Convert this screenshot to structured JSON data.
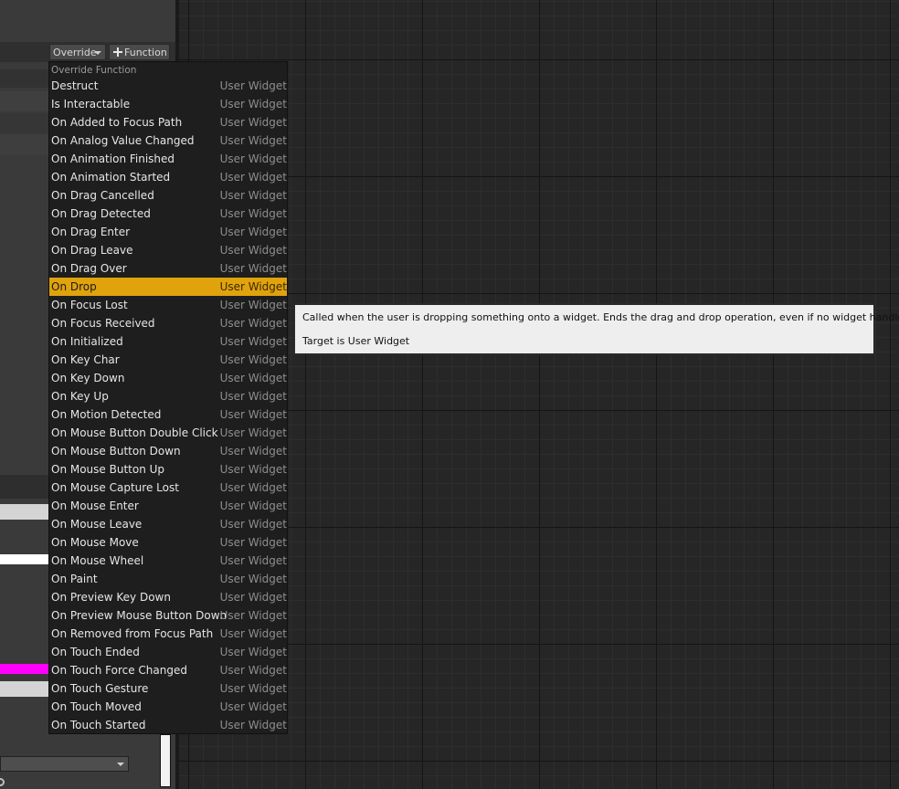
{
  "toolbar": {
    "override_label": "Override",
    "function_label": "Function"
  },
  "dropdown": {
    "header": "Override Function",
    "selected_index": 11,
    "items": [
      {
        "name": "Destruct",
        "type": "User Widget"
      },
      {
        "name": "Is Interactable",
        "type": "User Widget"
      },
      {
        "name": "On Added to Focus Path",
        "type": "User Widget"
      },
      {
        "name": "On Analog Value Changed",
        "type": "User Widget"
      },
      {
        "name": "On Animation Finished",
        "type": "User Widget"
      },
      {
        "name": "On Animation Started",
        "type": "User Widget"
      },
      {
        "name": "On Drag Cancelled",
        "type": "User Widget"
      },
      {
        "name": "On Drag Detected",
        "type": "User Widget"
      },
      {
        "name": "On Drag Enter",
        "type": "User Widget"
      },
      {
        "name": "On Drag Leave",
        "type": "User Widget"
      },
      {
        "name": "On Drag Over",
        "type": "User Widget"
      },
      {
        "name": "On Drop",
        "type": "User Widget"
      },
      {
        "name": "On Focus Lost",
        "type": "User Widget"
      },
      {
        "name": "On Focus Received",
        "type": "User Widget"
      },
      {
        "name": "On Initialized",
        "type": "User Widget"
      },
      {
        "name": "On Key Char",
        "type": "User Widget"
      },
      {
        "name": "On Key Down",
        "type": "User Widget"
      },
      {
        "name": "On Key Up",
        "type": "User Widget"
      },
      {
        "name": "On Motion Detected",
        "type": "User Widget"
      },
      {
        "name": "On Mouse Button Double Click",
        "type": "User Widget"
      },
      {
        "name": "On Mouse Button Down",
        "type": "User Widget"
      },
      {
        "name": "On Mouse Button Up",
        "type": "User Widget"
      },
      {
        "name": "On Mouse Capture Lost",
        "type": "User Widget"
      },
      {
        "name": "On Mouse Enter",
        "type": "User Widget"
      },
      {
        "name": "On Mouse Leave",
        "type": "User Widget"
      },
      {
        "name": "On Mouse Move",
        "type": "User Widget"
      },
      {
        "name": "On Mouse Wheel",
        "type": "User Widget"
      },
      {
        "name": "On Paint",
        "type": "User Widget"
      },
      {
        "name": "On Preview Key Down",
        "type": "User Widget"
      },
      {
        "name": "On Preview Mouse Button Down",
        "type": "User Widget"
      },
      {
        "name": "On Removed from Focus Path",
        "type": "User Widget"
      },
      {
        "name": "On Touch Ended",
        "type": "User Widget"
      },
      {
        "name": "On Touch Force Changed",
        "type": "User Widget"
      },
      {
        "name": "On Touch Gesture",
        "type": "User Widget"
      },
      {
        "name": "On Touch Moved",
        "type": "User Widget"
      },
      {
        "name": "On Touch Started",
        "type": "User Widget"
      }
    ]
  },
  "tooltip": {
    "description": "Called when the user is dropping something onto a widget.  Ends the drag and drop operation, even if no widget handles this.",
    "target": "Target is User Widget"
  },
  "colors": {
    "selected_highlight": "#e0a30c",
    "magenta_accent": "#ff00ff"
  },
  "icons": [
    "chevron-down-icon",
    "plus-icon",
    "search-icon"
  ]
}
